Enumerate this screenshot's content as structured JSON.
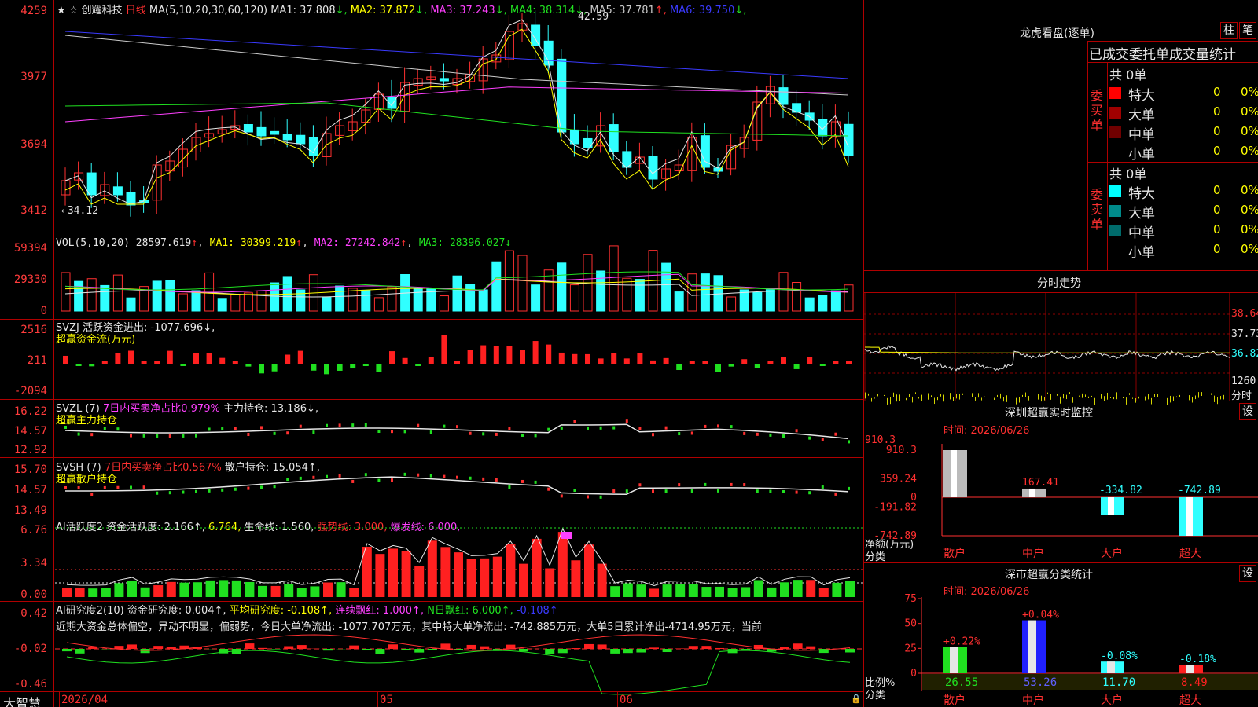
{
  "header": {
    "stock_name": "创耀科技",
    "period": "日线",
    "ma_params": "MA(5,10,20,30,60,120)",
    "ma": [
      {
        "label": "MA1:",
        "value": "37.808",
        "arrow": "↓",
        "color": "#e6e6e6"
      },
      {
        "label": "MA2:",
        "value": "37.872",
        "arrow": "↓",
        "color": "#ffff00"
      },
      {
        "label": "MA3:",
        "value": "37.243",
        "arrow": "↓",
        "color": "#ff40ff"
      },
      {
        "label": "MA4:",
        "value": "38.314",
        "arrow": "↓",
        "color": "#20e020"
      },
      {
        "label": "MA5:",
        "value": "37.781",
        "arrow": "↑",
        "color": "#c8c8c8"
      },
      {
        "label": "MA6:",
        "value": "39.750",
        "arrow": "↓",
        "color": "#3a3aff"
      }
    ]
  },
  "main_chart": {
    "y_ticks": [
      "4259",
      "3977",
      "3694",
      "3412"
    ],
    "high_label": "42.59",
    "low_label": "←34.12"
  },
  "vol": {
    "title": "VOL(5,10,20)",
    "value": "28597.619",
    "ma1": "MA1: 30399.219",
    "ma2": "MA2: 27242.842",
    "ma3": "MA3: 28396.027",
    "y_ticks": [
      "59394",
      "29330",
      "0"
    ]
  },
  "svzj": {
    "line1": "SVZJ  活跃资金进出: -1077.696↓,",
    "line2": "超赢资金流(万元)",
    "y_ticks": [
      "2516",
      "211",
      "-2094"
    ]
  },
  "svzl": {
    "title": "SVZL (7)",
    "ratio": "7日内买卖净占比0.979%",
    "hold": "主力持仓: 13.186↓,",
    "line2": "超赢主力持仓",
    "y_ticks": [
      "16.22",
      "14.57",
      "12.92"
    ]
  },
  "svsh": {
    "title": "SVSH (7)",
    "ratio": "7日内买卖净占比0.567%",
    "hold": "散户持仓: 15.054↑,",
    "line2": "超赢散户持仓",
    "y_ticks": [
      "15.70",
      "14.57",
      "13.49"
    ]
  },
  "ai_active": {
    "title": "AI活跃度2 资金活跃度: 2.166↑,",
    "v2": "6.764,",
    "life": "生命线: 1.560,",
    "strong": "强势线: 3.000,",
    "burst": "爆发线: 6.000,",
    "y_ticks": [
      "6.76",
      "3.34",
      "0.00"
    ]
  },
  "ai_research": {
    "title": "AI研究度2(10) 资金研究度: 0.004↑,",
    "avg": "平均研究度: -0.108↑,",
    "red": "连续飘红: 1.000↑,",
    "nday": "N日飘红: 6.000↑,",
    "last": "-0.108↑",
    "summary": "近期大资金总体偏空，异动不明显，偏弱势，今日大单净流出: -1077.707万元，其中特大单净流出: -742.885万元，大单5日累计净出-4714.95万元，当前",
    "y_ticks": [
      "0.42",
      "-0.02",
      "-0.46"
    ]
  },
  "x_axis": {
    "labels": [
      "2026/04",
      "05",
      "06"
    ],
    "app_name": "大智慧"
  },
  "dragon_tiger": {
    "title": "龙虎看盘(逐单)",
    "btn_bar": "柱",
    "btn_pen": "笔",
    "subtitle": "已成交委托单成交量统计",
    "buy_label": "委买单",
    "sell_label": "委卖单",
    "buy_total": "共 0单",
    "sell_total": "共 0单",
    "buy_rows": [
      {
        "name": "特大",
        "count": "0",
        "pct": "0%",
        "color": "#ff0000"
      },
      {
        "name": "大单",
        "count": "0",
        "pct": "0%",
        "color": "#a00000"
      },
      {
        "name": "中单",
        "count": "0",
        "pct": "0%",
        "color": "#700000"
      },
      {
        "name": "小单",
        "count": "0",
        "pct": "0%",
        "color": "#000000"
      }
    ],
    "sell_rows": [
      {
        "name": "特大",
        "count": "0",
        "pct": "0%",
        "color": "#00ffff"
      },
      {
        "name": "大单",
        "count": "0",
        "pct": "0%",
        "color": "#008b8b"
      },
      {
        "name": "中单",
        "count": "0",
        "pct": "0%",
        "color": "#006b6b"
      },
      {
        "name": "小单",
        "count": "0",
        "pct": "0%",
        "color": "#000000"
      }
    ]
  },
  "intraday": {
    "title": "分时走势",
    "y_ticks": [
      "38.64",
      "37.73",
      "36.82"
    ],
    "vol_tick": "1260",
    "vol_unit": "分时"
  },
  "sz_monitor": {
    "title": "深圳超赢实时监控",
    "btn": "设",
    "time": "时间: 2026/06/26",
    "y_ticks": [
      "910.3",
      "359.24",
      "0",
      "-191.82",
      "-742.89"
    ],
    "unit": "净额(万元)",
    "cat_label": "分类",
    "chart_data": {
      "type": "bar",
      "categories": [
        "散户",
        "中户",
        "大户",
        "超大"
      ],
      "values": [
        910.3,
        167.41,
        -334.82,
        -742.89
      ],
      "value_labels": [
        "910.3",
        "167.41",
        "-334.82",
        "-742.89"
      ],
      "ylim": [
        -742.89,
        910.3
      ]
    }
  },
  "sz_class": {
    "title": "深市超赢分类统计",
    "btn": "设",
    "time": "时间: 2026/06/26",
    "y_ticks": [
      "75",
      "50",
      "25",
      "0"
    ],
    "unit": "比例%",
    "cat_label": "分类",
    "chart_data": {
      "type": "bar",
      "categories": [
        "散户",
        "中户",
        "大户",
        "超大"
      ],
      "values": [
        26.55,
        53.26,
        11.7,
        8.49
      ],
      "value_labels": [
        "26.55",
        "53.26",
        "11.70",
        "8.49"
      ],
      "changes": [
        "+0.22%",
        "+0.04%",
        "-0.08%",
        "-0.18%"
      ],
      "ylim": [
        0,
        75
      ]
    }
  }
}
